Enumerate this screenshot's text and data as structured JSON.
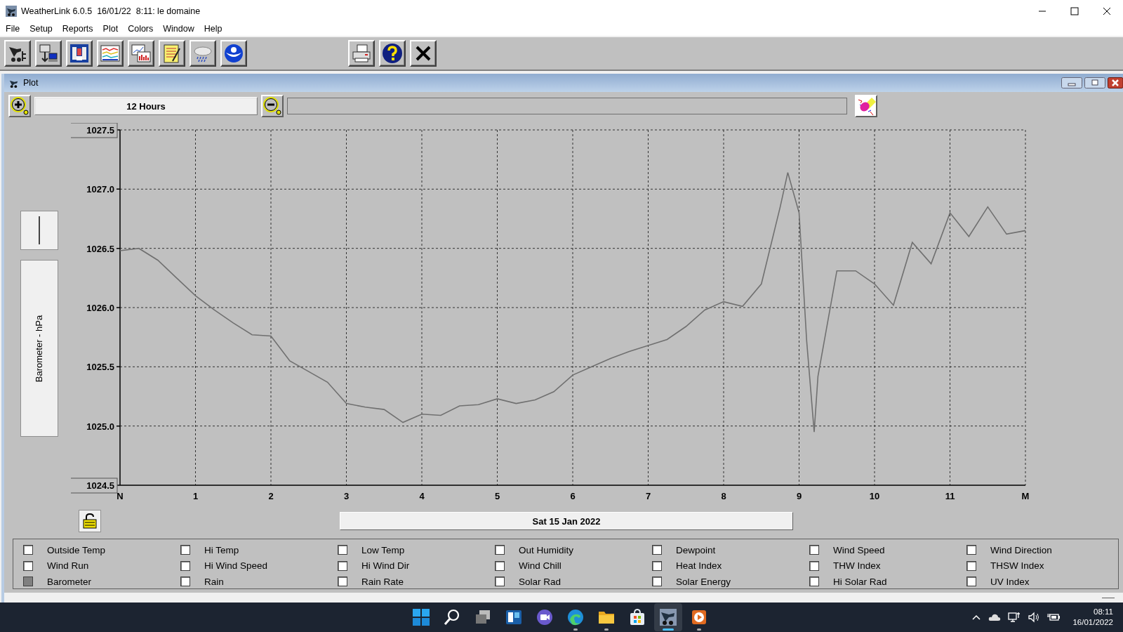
{
  "window": {
    "title": "WeatherLink 6.0.5  16/01/22  8:11: le domaine"
  },
  "menu": [
    {
      "label": "File"
    },
    {
      "label": "Setup"
    },
    {
      "label": "Reports"
    },
    {
      "label": "Plot"
    },
    {
      "label": "Colors"
    },
    {
      "label": "Window"
    },
    {
      "label": "Help"
    }
  ],
  "plot_window": {
    "title": "Plot",
    "zoom_range": "12 Hours",
    "date_label": "Sat 15 Jan 2022",
    "y_axis_label": "Barometer - hPa",
    "chart_data": {
      "type": "line",
      "grid": true,
      "ylim": [
        1024.5,
        1027.5
      ],
      "xlim": [
        0,
        12
      ],
      "yticks": [
        {
          "value": 1027.5,
          "label": "1027.5"
        },
        {
          "value": 1027.0,
          "label": "1027.0"
        },
        {
          "value": 1026.5,
          "label": "1026.5"
        },
        {
          "value": 1026.0,
          "label": "1026.0"
        },
        {
          "value": 1025.5,
          "label": "1025.5"
        },
        {
          "value": 1025.0,
          "label": "1025.0"
        },
        {
          "value": 1024.5,
          "label": "1024.5"
        }
      ],
      "xticks": [
        {
          "value": 0,
          "label": "N"
        },
        {
          "value": 1,
          "label": "1"
        },
        {
          "value": 2,
          "label": "2"
        },
        {
          "value": 3,
          "label": "3"
        },
        {
          "value": 4,
          "label": "4"
        },
        {
          "value": 5,
          "label": "5"
        },
        {
          "value": 6,
          "label": "6"
        },
        {
          "value": 7,
          "label": "7"
        },
        {
          "value": 8,
          "label": "8"
        },
        {
          "value": 9,
          "label": "9"
        },
        {
          "value": 10,
          "label": "10"
        },
        {
          "value": 11,
          "label": "11"
        },
        {
          "value": 12,
          "label": "M"
        }
      ],
      "x": [
        0,
        0.25,
        0.5,
        0.75,
        1,
        1.25,
        1.5,
        1.75,
        2,
        2.25,
        2.5,
        2.75,
        3,
        3.25,
        3.5,
        3.75,
        4,
        4.25,
        4.5,
        4.75,
        5,
        5.25,
        5.5,
        5.75,
        6,
        6.25,
        6.5,
        6.75,
        7,
        7.25,
        7.5,
        7.75,
        8,
        8.25,
        8.5,
        8.75,
        8.85,
        9,
        9.1,
        9.2,
        9.25,
        9.5,
        9.75,
        10,
        10.25,
        10.5,
        10.75,
        11,
        11.25,
        11.5,
        11.75,
        12
      ],
      "series": [
        {
          "color": "#707070",
          "values": [
            1026.48,
            1026.5,
            1026.4,
            1026.25,
            1026.1,
            1025.98,
            1025.87,
            1025.77,
            1025.76,
            1025.55,
            1025.46,
            1025.37,
            1025.19,
            1025.16,
            1025.14,
            1025.03,
            1025.1,
            1025.09,
            1025.17,
            1025.18,
            1025.23,
            1025.19,
            1025.22,
            1025.29,
            1025.43,
            1025.5,
            1025.57,
            1025.63,
            1025.68,
            1025.73,
            1025.84,
            1025.98,
            1026.05,
            1026.01,
            1026.2,
            1026.85,
            1027.14,
            1026.8,
            1025.72,
            1024.95,
            1025.42,
            1026.31,
            1026.31,
            1026.2,
            1026.02,
            1026.55,
            1026.37,
            1026.8,
            1026.6,
            1026.85,
            1026.62,
            1026.65
          ]
        }
      ]
    },
    "legend": [
      {
        "label": "Outside Temp",
        "checked": false
      },
      {
        "label": "Hi Temp",
        "checked": false
      },
      {
        "label": "Low Temp",
        "checked": false
      },
      {
        "label": "Out Humidity",
        "checked": false
      },
      {
        "label": "Dewpoint",
        "checked": false
      },
      {
        "label": "Wind Speed",
        "checked": false
      },
      {
        "label": "Wind Direction",
        "checked": false
      },
      {
        "label": "Wind Run",
        "checked": false
      },
      {
        "label": "Hi Wind Speed",
        "checked": false
      },
      {
        "label": "Hi Wind Dir",
        "checked": false
      },
      {
        "label": "Wind Chill",
        "checked": false
      },
      {
        "label": "Heat Index",
        "checked": false
      },
      {
        "label": "THW Index",
        "checked": false
      },
      {
        "label": "THSW Index",
        "checked": false
      },
      {
        "label": "Barometer",
        "checked": true
      },
      {
        "label": "Rain",
        "checked": false
      },
      {
        "label": "Rain Rate",
        "checked": false
      },
      {
        "label": "Solar Rad",
        "checked": false
      },
      {
        "label": "Solar Energy",
        "checked": false
      },
      {
        "label": "Hi Solar Rad",
        "checked": false
      },
      {
        "label": "UV Index",
        "checked": false
      }
    ]
  },
  "taskbar": {
    "apps": [
      {
        "kind": "start",
        "running": false,
        "selected": false
      },
      {
        "kind": "search",
        "running": false,
        "selected": false
      },
      {
        "kind": "taskview",
        "running": false,
        "selected": false
      },
      {
        "kind": "widgets",
        "running": false,
        "selected": false
      },
      {
        "kind": "chat",
        "running": false,
        "selected": false
      },
      {
        "kind": "edge",
        "running": true,
        "selected": false
      },
      {
        "kind": "explorer",
        "running": true,
        "selected": false
      },
      {
        "kind": "store",
        "running": false,
        "selected": false
      },
      {
        "kind": "weatherlink",
        "running": true,
        "selected": true
      },
      {
        "kind": "media",
        "running": true,
        "selected": false
      }
    ],
    "time": "08:11",
    "date": "16/01/2022"
  }
}
